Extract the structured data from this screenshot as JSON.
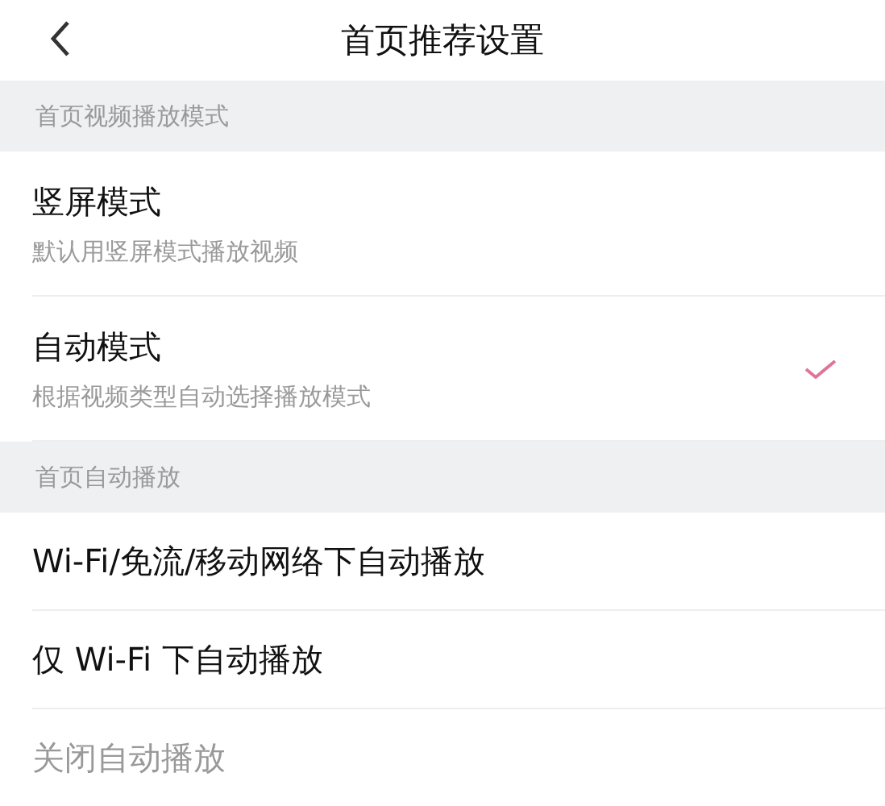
{
  "header": {
    "title": "首页推荐设置"
  },
  "sections": [
    {
      "title": "首页视频播放模式",
      "options": [
        {
          "label": "竖屏模式",
          "description": "默认用竖屏模式播放视频",
          "selected": false,
          "disabled": false
        },
        {
          "label": "自动模式",
          "description": "根据视频类型自动选择播放模式",
          "selected": true,
          "disabled": false
        }
      ]
    },
    {
      "title": "首页自动播放",
      "options": [
        {
          "label": "Wi-Fi/免流/移动网络下自动播放",
          "selected": false,
          "disabled": false
        },
        {
          "label": "仅 Wi-Fi 下自动播放",
          "selected": false,
          "disabled": false
        },
        {
          "label": "关闭自动播放",
          "selected": false,
          "disabled": true
        }
      ]
    }
  ]
}
